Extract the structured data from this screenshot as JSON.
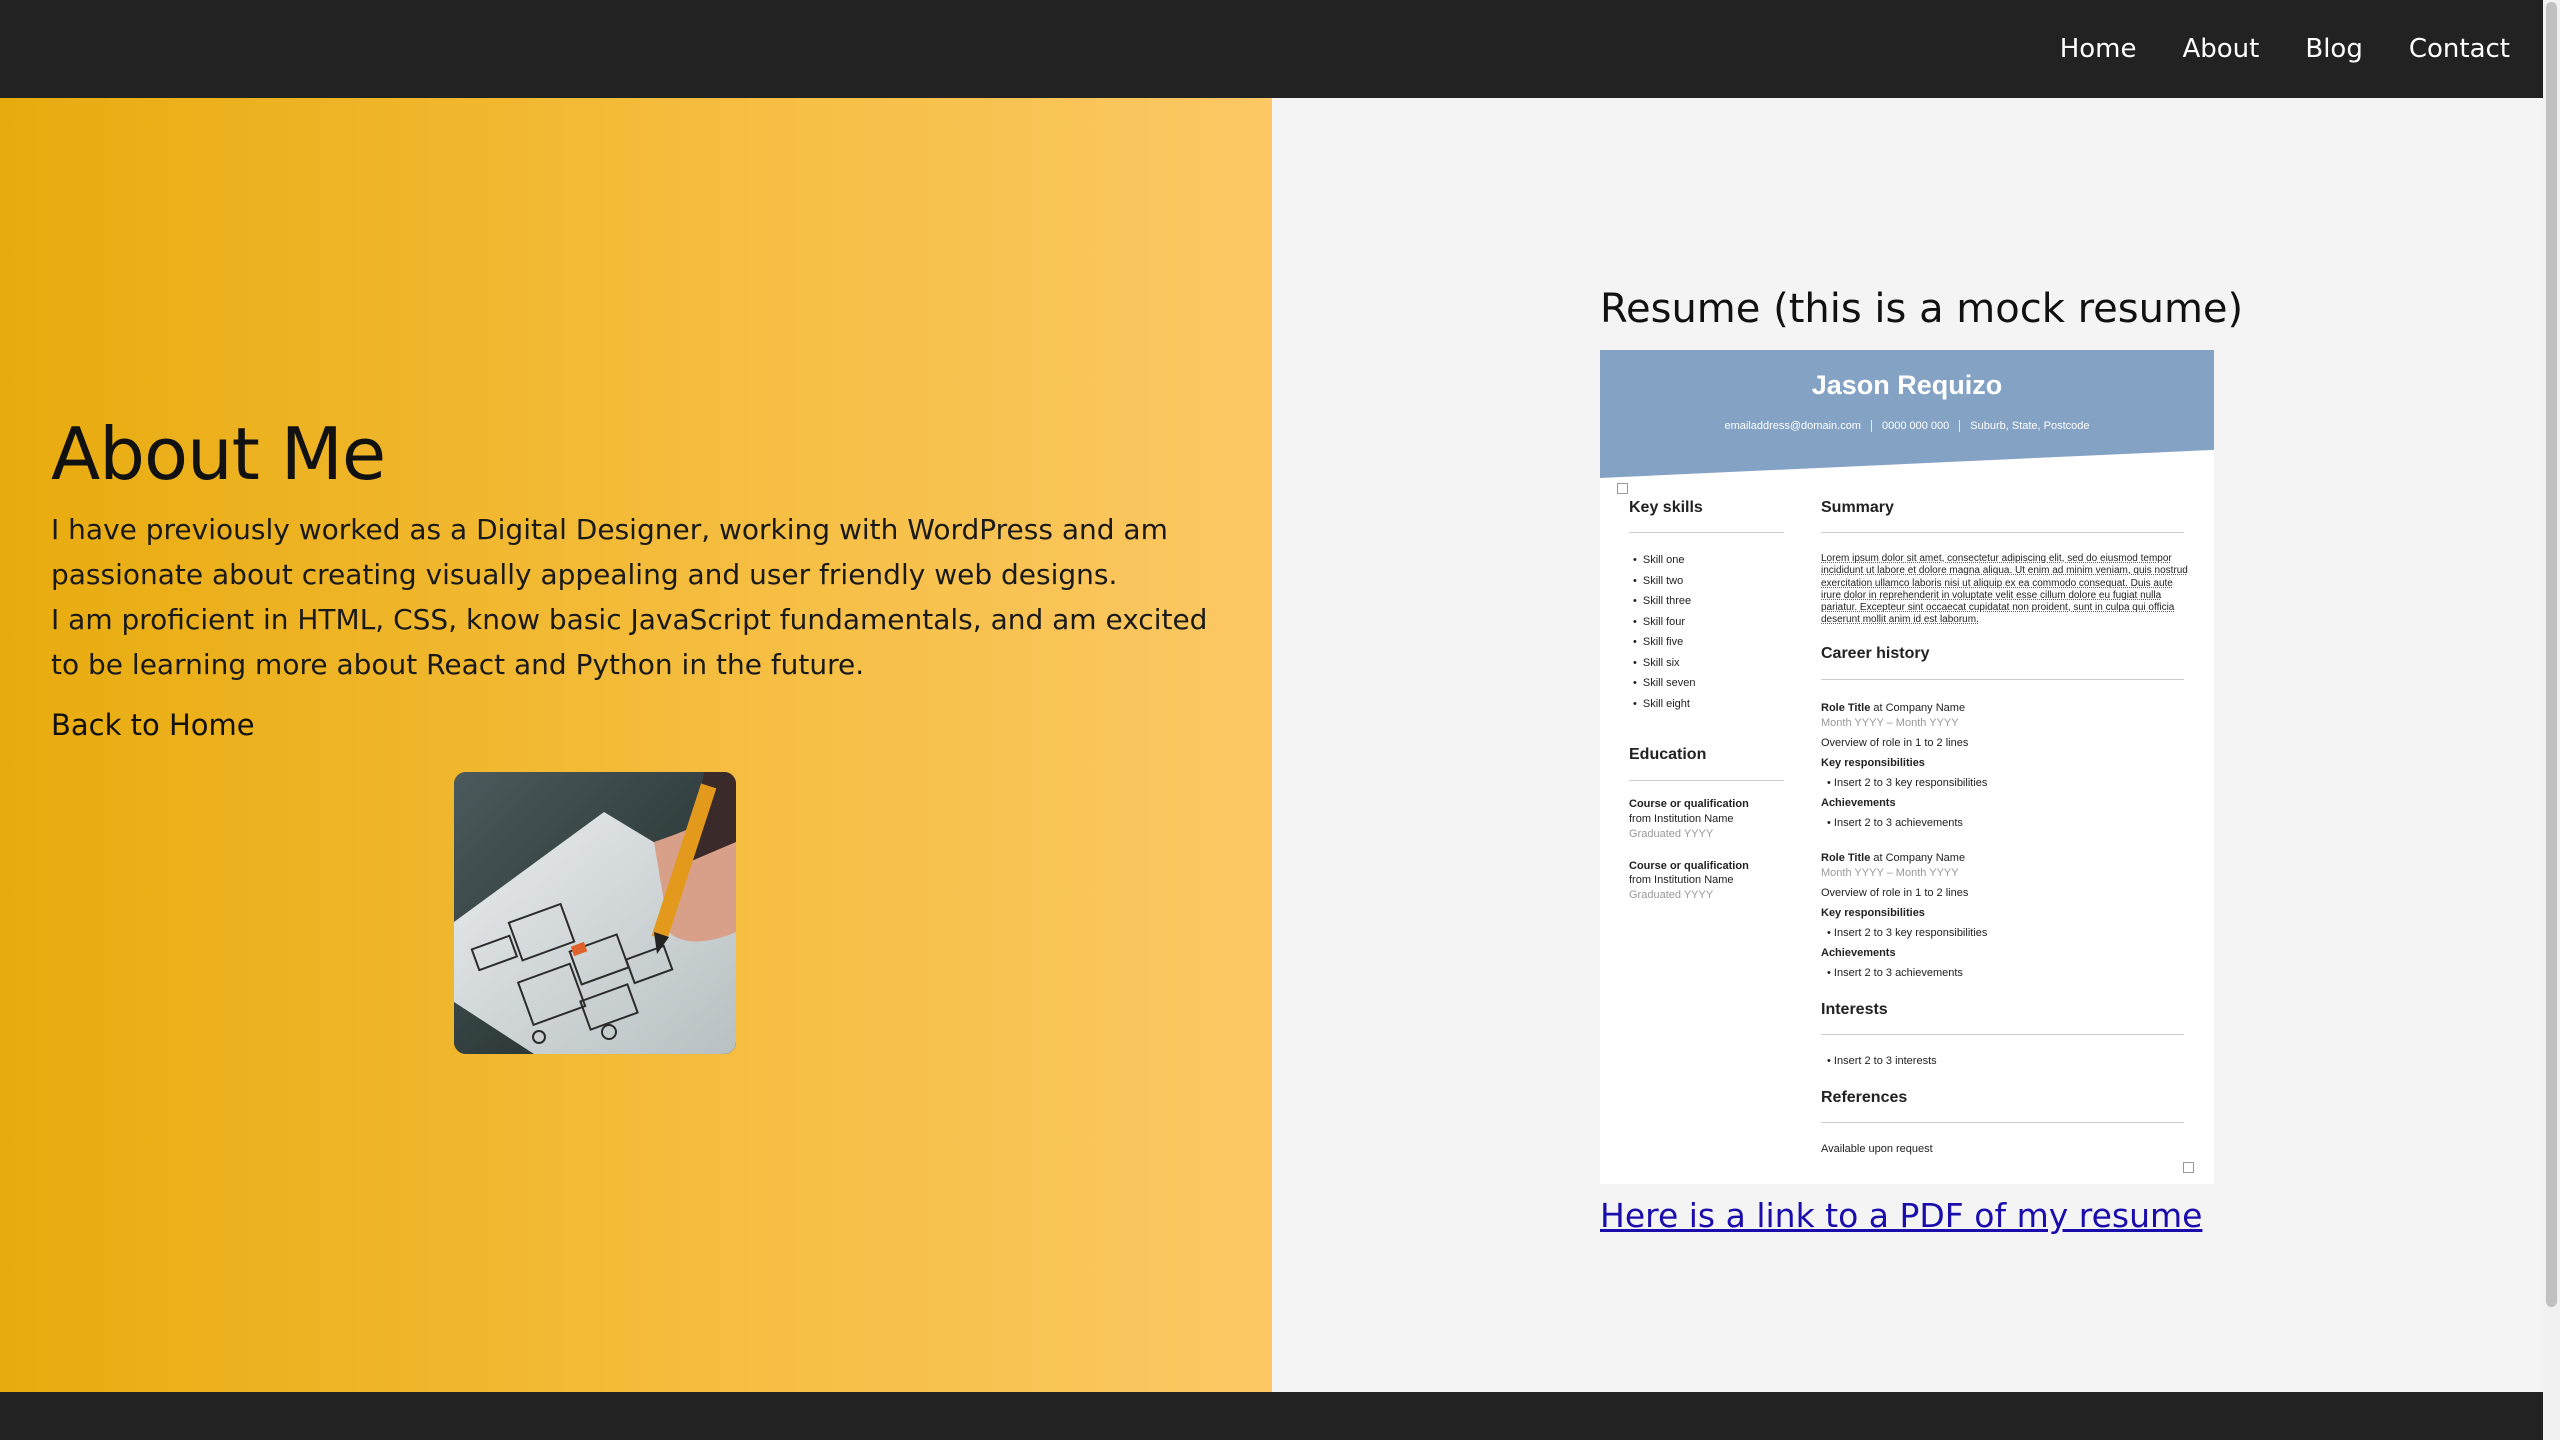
{
  "nav": {
    "items": [
      "Home",
      "About",
      "Blog",
      "Contact"
    ]
  },
  "about": {
    "title": "About Me",
    "paragraph1": "I have previously worked as a Digital Designer, working with WordPress and am passionate about creating visually appealing and user friendly web designs.",
    "paragraph2": "I am proficient in HTML, CSS, know basic JavaScript fundamentals, and am excited to be learning more about React and Python in the future.",
    "back_link": "Back to Home"
  },
  "resume": {
    "title": "Resume (this is a mock resume)",
    "name": "Jason Requizo",
    "contact": [
      "emailaddress@domain.com",
      "0000 000 000",
      "Suburb, State, Postcode"
    ],
    "key_skills_heading": "Key skills",
    "skills": [
      "Skill one",
      "Skill two",
      "Skill three",
      "Skill four",
      "Skill five",
      "Skill six",
      "Skill seven",
      "Skill eight"
    ],
    "education_heading": "Education",
    "education": [
      {
        "line1": "Course or qualification",
        "line2": "from Institution Name",
        "grad": "Graduated YYYY"
      },
      {
        "line1": "Course or qualification",
        "line2": "from Institution Name",
        "grad": "Graduated YYYY"
      }
    ],
    "summary_heading": "Summary",
    "summary_text": "Lorem ipsum dolor sit amet, consectetur adipiscing elit, sed do eiusmod tempor incididunt ut labore et dolore magna aliqua. Ut enim ad minim veniam, quis nostrud exercitation ullamco laboris nisi ut aliquip ex ea commodo consequat. Duis aute irure dolor in reprehenderit in voluptate velit esse cillum dolore eu fugiat nulla pariatur. Excepteur sint occaecat cupidatat non proident, sunt in culpa qui officia deserunt mollit anim id est laborum.",
    "career_heading": "Career history",
    "roles": [
      {
        "role": "Role Title",
        "at": " at Company Name",
        "dates": "Month YYYY – Month YYYY",
        "overview": "Overview of role in 1 to 2 lines",
        "resp_heading": "Key responsibilities",
        "resp": "Insert 2 to 3 key responsibilities",
        "ach_heading": "Achievements",
        "ach": "Insert 2 to 3 achievements"
      },
      {
        "role": "Role Title",
        "at": " at Company Name",
        "dates": "Month YYYY – Month YYYY",
        "overview": "Overview of role in 1 to 2 lines",
        "resp_heading": "Key responsibilities",
        "resp": "Insert 2 to 3 key responsibilities",
        "ach_heading": "Achievements",
        "ach": "Insert 2 to 3 achievements"
      }
    ],
    "interests_heading": "Interests",
    "interests": "Insert 2 to 3 interests",
    "references_heading": "References",
    "references": "Available upon request",
    "pdf_link": "Here is a link to a PDF of my resume"
  },
  "colors": {
    "navbar": "#222222",
    "panel_gradient_start": "#e8ab0e",
    "panel_gradient_end": "#fcc865",
    "resume_header": "#84a2c4",
    "link": "#1a0dab"
  }
}
